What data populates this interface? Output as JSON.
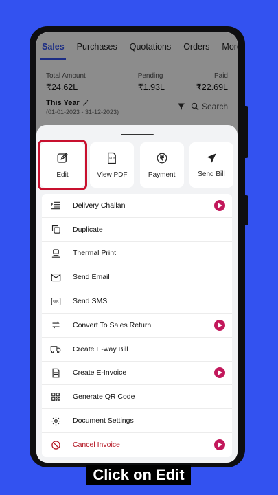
{
  "tabs": [
    "Sales",
    "Purchases",
    "Quotations",
    "Orders",
    "More"
  ],
  "summary": {
    "total": {
      "label": "Total Amount",
      "value": "₹24.62L"
    },
    "pending": {
      "label": "Pending",
      "value": "₹1.93L"
    },
    "paid": {
      "label": "Paid",
      "value": "₹22.69L"
    }
  },
  "period": {
    "title": "This Year",
    "range": "(01-01-2023 - 31-12-2023)",
    "search_label": "Search"
  },
  "actions": [
    {
      "label": "Edit",
      "icon": "edit-icon",
      "highlighted": true
    },
    {
      "label": "View PDF",
      "icon": "pdf-icon"
    },
    {
      "label": "Payment",
      "icon": "rupee-icon"
    },
    {
      "label": "Send Bill",
      "icon": "send-icon"
    }
  ],
  "menu": [
    {
      "label": "Delivery Challan",
      "icon": "truck-list-icon",
      "video": true
    },
    {
      "label": "Duplicate",
      "icon": "duplicate-icon",
      "video": false
    },
    {
      "label": "Thermal Print",
      "icon": "printer-icon",
      "video": false
    },
    {
      "label": "Send Email",
      "icon": "email-icon",
      "video": false
    },
    {
      "label": "Send SMS",
      "icon": "sms-icon",
      "video": false
    },
    {
      "label": "Convert To Sales Return",
      "icon": "convert-icon",
      "video": true
    },
    {
      "label": "Create E-way Bill",
      "icon": "delivery-truck-icon",
      "video": false
    },
    {
      "label": "Create E-Invoice",
      "icon": "invoice-icon",
      "video": true
    },
    {
      "label": "Generate QR Code",
      "icon": "qr-code-icon",
      "video": false
    },
    {
      "label": "Document Settings",
      "icon": "gear-icon",
      "video": false
    },
    {
      "label": "Cancel Invoice",
      "icon": "cancel-icon",
      "video": true,
      "danger": true
    }
  ],
  "caption": "Click on Edit",
  "colors": {
    "background": "#3352f0",
    "accent": "#3352f0",
    "highlight": "#c8102e",
    "video_badge": "#c2185b"
  }
}
